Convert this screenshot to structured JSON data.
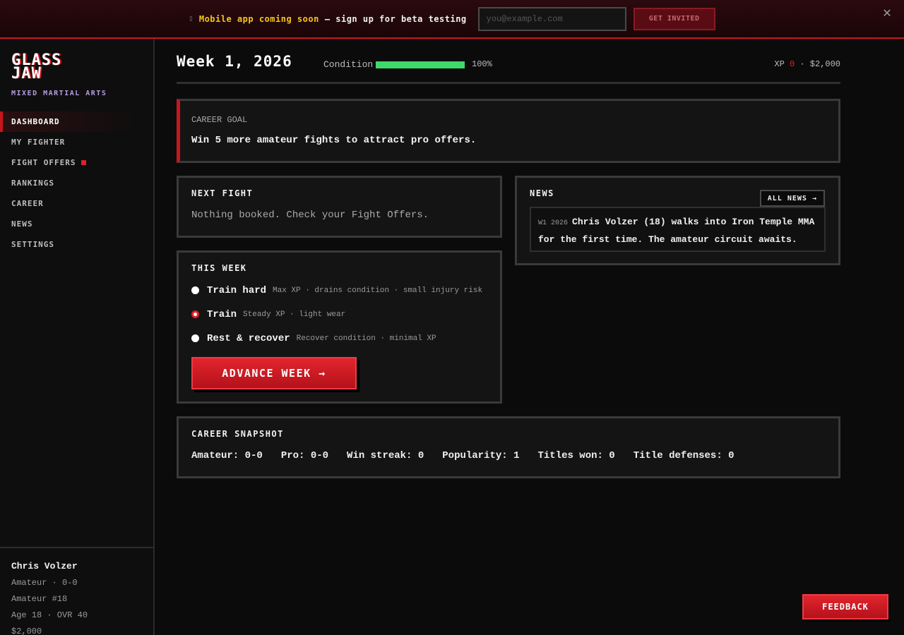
{
  "banner": {
    "icon": "phone-icon",
    "highlight": "Mobile app coming soon",
    "text": "— sign up for beta testing",
    "email_placeholder": "you@example.com",
    "button_label": "GET INVITED",
    "close_glyph": "✕"
  },
  "sidebar": {
    "logo_line1": "GLASS",
    "logo_line2": "JAW",
    "tagline": "MIXED MARTIAL ARTS",
    "items": [
      {
        "label": "DASHBOARD"
      },
      {
        "label": "MY FIGHTER"
      },
      {
        "label": "FIGHT OFFERS"
      },
      {
        "label": "RANKINGS"
      },
      {
        "label": "CAREER"
      },
      {
        "label": "NEWS"
      },
      {
        "label": "SETTINGS"
      }
    ],
    "footer": {
      "name": "Chris Volzer",
      "record": "Amateur · 0-0",
      "rank": "Amateur #18",
      "age_ovr": "Age 18 · OVR 40",
      "money": "$2,000"
    }
  },
  "topbar": {
    "week": "Week 1, 2026",
    "condition_label": "Condition",
    "condition_value": 1.0,
    "condition_pct": "100%",
    "xp_label": "XP",
    "xp_value": "0",
    "money": "· $2,000"
  },
  "goal": {
    "label": "CAREER GOAL",
    "text": "Win 5 more amateur fights to attract pro offers."
  },
  "next_fight": {
    "title": "NEXT FIGHT",
    "body": "Nothing booked. Check your Fight Offers."
  },
  "this_week": {
    "title": "THIS WEEK",
    "options": [
      {
        "name": "Train hard",
        "desc": "Max XP · drains condition · small injury risk"
      },
      {
        "name": "Train",
        "desc": "Steady XP · light wear"
      },
      {
        "name": "Rest & recover",
        "desc": "Recover condition · minimal XP"
      }
    ],
    "selected_index": 1,
    "advance_label": "ADVANCE WEEK →"
  },
  "news": {
    "title": "NEWS",
    "all_label": "ALL NEWS →",
    "items": [
      {
        "date": "W1 2026",
        "text": "Chris Volzer (18) walks into Iron Temple MMA for the first time. The amateur circuit awaits."
      }
    ]
  },
  "snapshot": {
    "title": "CAREER SNAPSHOT",
    "stats": [
      "Amateur: 0-0",
      "Pro: 0-0",
      "Win streak: 0",
      "Popularity: 1",
      "Titles won: 0",
      "Title defenses: 0"
    ]
  },
  "feedback_label": "FEEDBACK",
  "colors": {
    "accent": "#c8161e",
    "condition": "#3ed96a",
    "banner_highlight": "#f5c518",
    "tagline": "#b49ce0"
  }
}
